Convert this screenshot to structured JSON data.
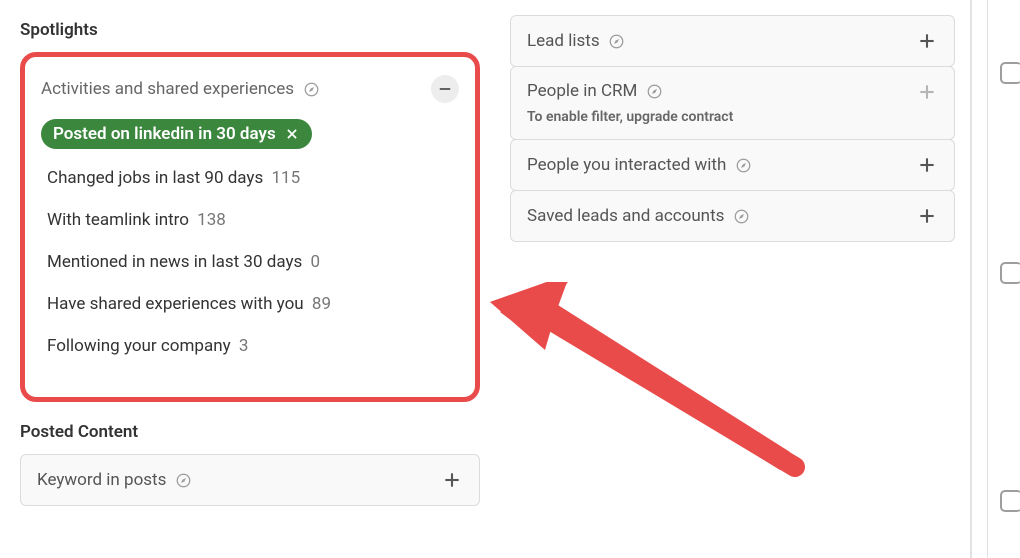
{
  "left": {
    "spotlights_heading": "Spotlights",
    "activities_title": "Activities and shared experiences",
    "pill_label": "Posted on linkedin in 30 days",
    "options": [
      {
        "label": "Changed jobs in last 90 days",
        "count": "115"
      },
      {
        "label": "With teamlink intro",
        "count": "138"
      },
      {
        "label": "Mentioned in news in last 30 days",
        "count": "0"
      },
      {
        "label": "Have shared experiences with you",
        "count": "89"
      },
      {
        "label": "Following your company",
        "count": "3"
      }
    ],
    "posted_content_heading": "Posted Content",
    "keyword_in_posts": "Keyword in posts"
  },
  "right": {
    "filters": [
      {
        "title": "Lead lists",
        "has_icon": true,
        "disabled": false,
        "sub": ""
      },
      {
        "title": "People in CRM",
        "has_icon": true,
        "disabled": true,
        "sub": "To enable filter, upgrade contract"
      },
      {
        "title": "People you interacted with",
        "has_icon": true,
        "disabled": false,
        "sub": ""
      },
      {
        "title": "Saved leads and accounts",
        "has_icon": true,
        "disabled": false,
        "sub": ""
      }
    ]
  }
}
